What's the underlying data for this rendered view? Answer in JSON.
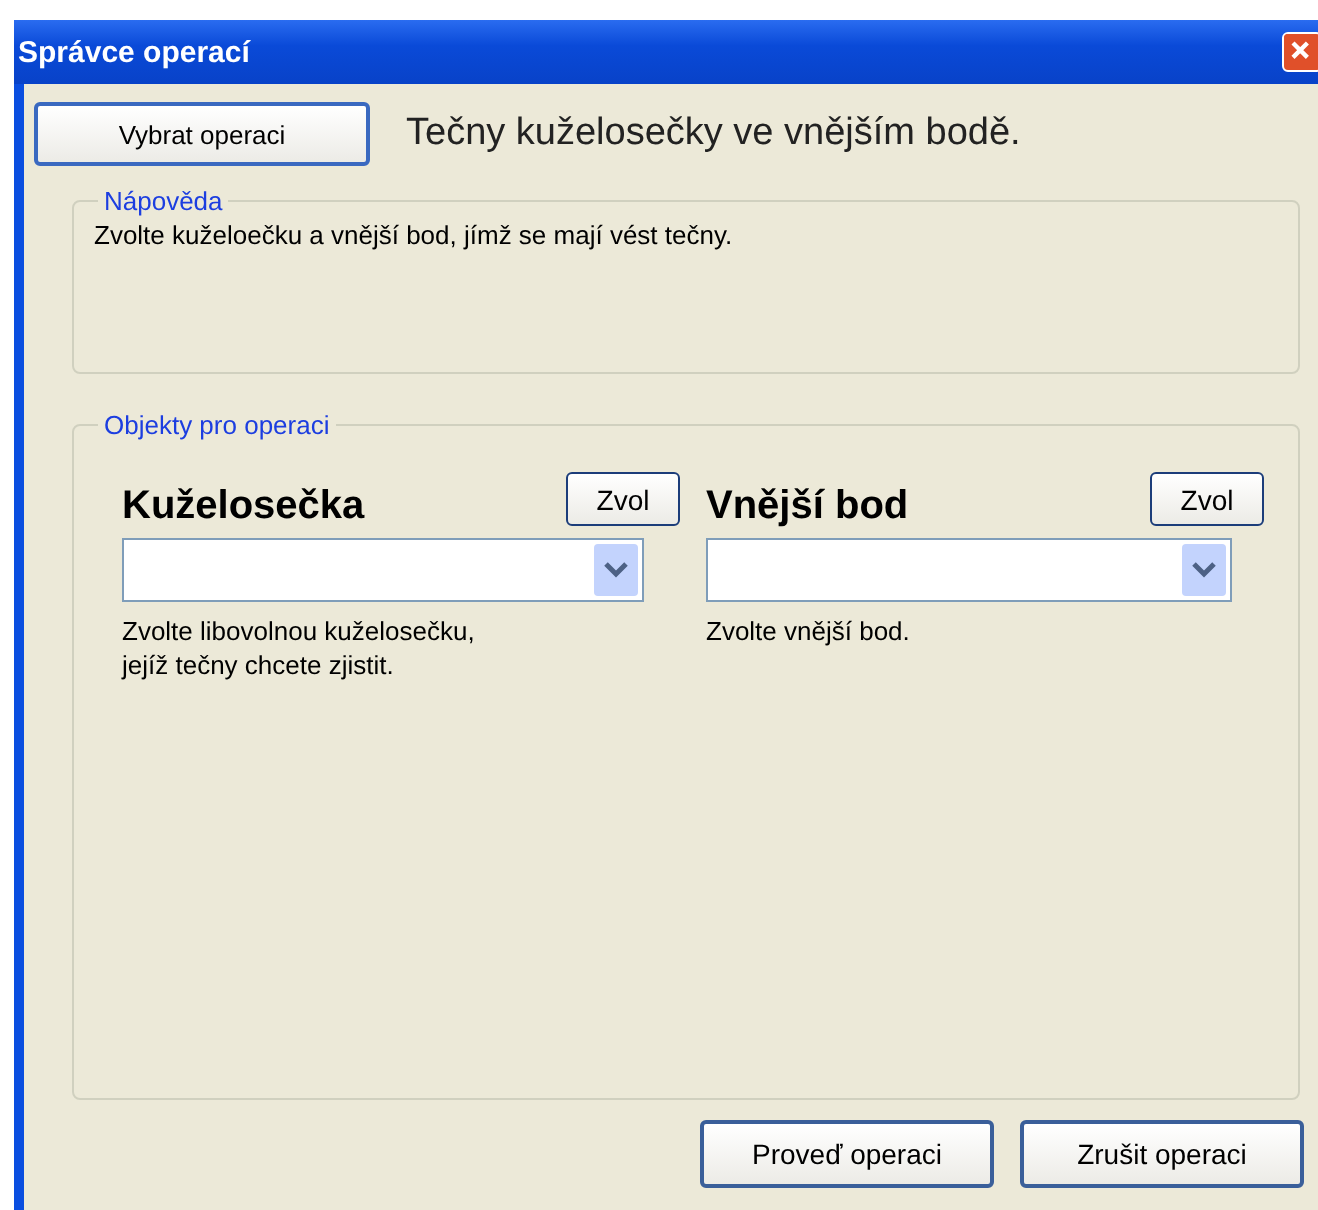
{
  "window": {
    "title": "Správce operací"
  },
  "select_button": "Vybrat operaci",
  "operation_title": "Tečny kuželosečky ve vnějším bodě.",
  "help": {
    "legend": "Nápověda",
    "text": "Zvolte kuželoečku a vnější bod, jímž se mají vést tečny."
  },
  "objects": {
    "legend": "Objekty pro operaci",
    "items": [
      {
        "label": "Kuželosečka",
        "pick_button": "Zvol",
        "hint": "Zvolte libovolnou kuželosečku,\njejíž tečny chcete zjistit."
      },
      {
        "label": "Vnější bod",
        "pick_button": "Zvol",
        "hint": "Zvolte vnější bod."
      }
    ]
  },
  "buttons": [
    "Proveď operaci",
    "Zrušit operaci"
  ]
}
